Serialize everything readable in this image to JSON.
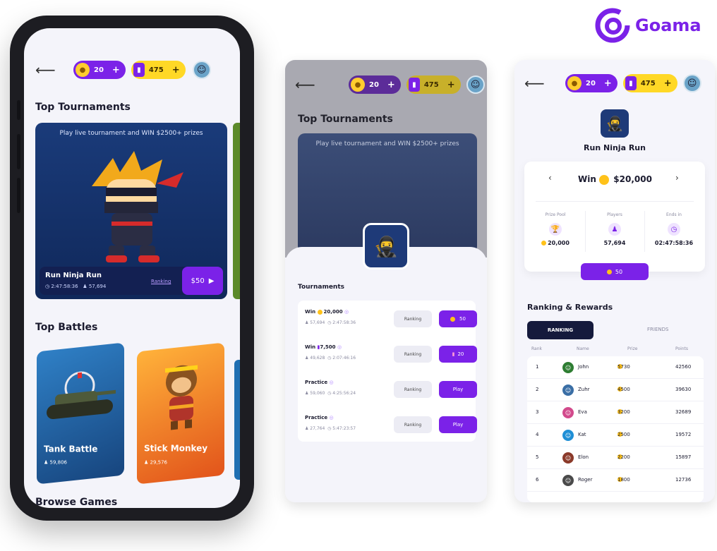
{
  "brand": {
    "name": "Goama",
    "color": "#7b22e8"
  },
  "currency": {
    "coins": "20",
    "tickets": "475"
  },
  "screen1": {
    "top_tournaments_title": "Top Tournaments",
    "hero": {
      "caption": "Play live tournament and WIN $2500+ prizes",
      "game_name": "Run Ninja Run",
      "time": "2:47:58:36",
      "players": "57,694",
      "ranking_link": "Ranking",
      "play_label": "$50"
    },
    "top_battles_title": "Top Battles",
    "battles": [
      {
        "name": "Tank Battle",
        "players": "59,806"
      },
      {
        "name": "Stick Monkey",
        "players": "29,576"
      }
    ],
    "browse_games_title": "Browse Games"
  },
  "screen2": {
    "top_tournaments_title": "Top Tournaments",
    "hero_caption": "Play live tournament and WIN $2500+ prizes",
    "tournaments_title": "Tournaments",
    "rows": [
      {
        "title": "Win",
        "prize": "20,000",
        "players": "57,694",
        "time": "2:47:58:36",
        "ranking": "Ranking",
        "action": "50"
      },
      {
        "title": "Win",
        "prize": "7,500",
        "players": "49,628",
        "time": "2:07:46:16",
        "ranking": "Ranking",
        "action": "20"
      },
      {
        "title": "Practice",
        "prize": "",
        "players": "59,060",
        "time": "4:25:56:24",
        "ranking": "Ranking",
        "action": "Play"
      },
      {
        "title": "Practice",
        "prize": "",
        "players": "27,764",
        "time": "5:47:23:57",
        "ranking": "Ranking",
        "action": "Play"
      }
    ]
  },
  "screen3": {
    "game_name": "Run Ninja Run",
    "win_label": "Win",
    "win_amount": "$20,000",
    "stats": [
      {
        "label": "Prize Pool",
        "value": "20,000",
        "icon": "trophy-icon"
      },
      {
        "label": "Players",
        "value": "57,694",
        "icon": "players-icon"
      },
      {
        "label": "Ends in",
        "value": "02:47:58:36",
        "icon": "clock-icon"
      }
    ],
    "entry_label": "50",
    "ranking_title": "Ranking & Rewards",
    "tabs": {
      "active": "RANKING",
      "other": "FRIENDS"
    },
    "columns": {
      "rank": "Rank",
      "name": "Name",
      "prize": "Prize",
      "points": "Points"
    },
    "leaderboard": [
      {
        "rank": "1",
        "name": "John",
        "prize": "5730",
        "points": "42560",
        "avatar_color": "#2e7d32"
      },
      {
        "rank": "2",
        "name": "Zuhr",
        "prize": "4500",
        "points": "39630",
        "avatar_color": "#3a6ea5"
      },
      {
        "rank": "3",
        "name": "Eva",
        "prize": "3200",
        "points": "32689",
        "avatar_color": "#d24a8c"
      },
      {
        "rank": "4",
        "name": "Kat",
        "prize": "2500",
        "points": "19572",
        "avatar_color": "#1f8fd6"
      },
      {
        "rank": "5",
        "name": "Elon",
        "prize": "2200",
        "points": "15897",
        "avatar_color": "#8b3a2a"
      },
      {
        "rank": "6",
        "name": "Roger",
        "prize": "1800",
        "points": "12736",
        "avatar_color": "#4a4a4a"
      }
    ]
  },
  "colors": {
    "purple": "#7b22e8",
    "yellow": "#ffd826",
    "navy": "#151a3c",
    "coin": "#ffc21a"
  }
}
